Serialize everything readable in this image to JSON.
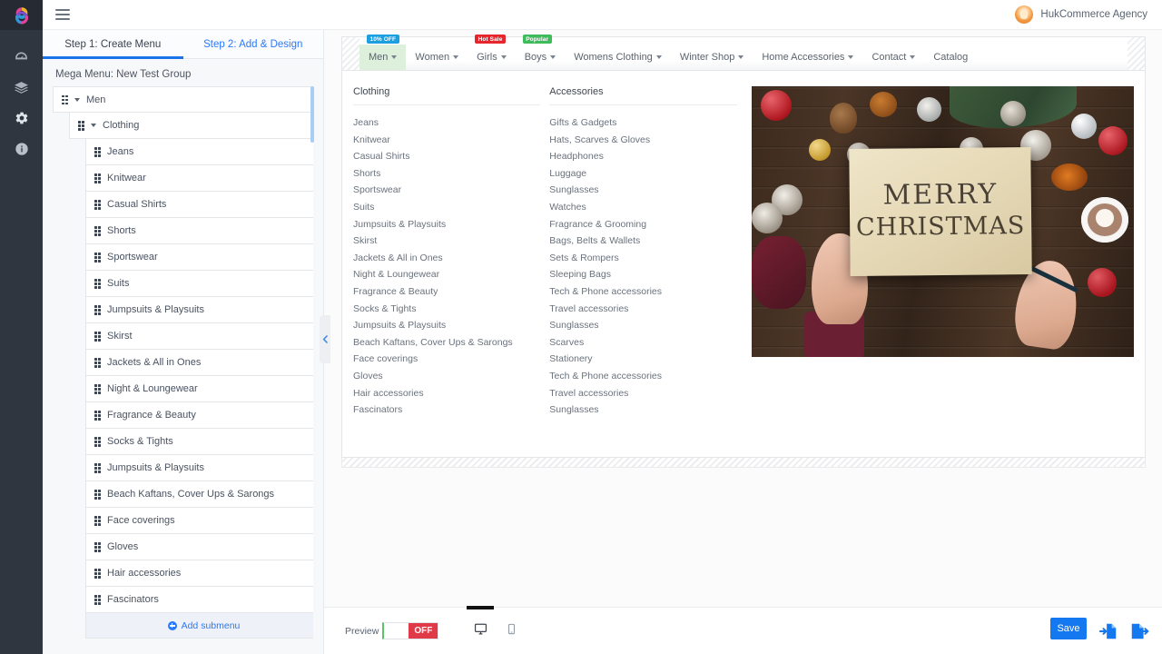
{
  "rail": {
    "logo_icon": "app-logo",
    "items": [
      {
        "icon": "dashboard-gauge-icon",
        "name": "dashboard"
      },
      {
        "icon": "layers-icon",
        "name": "layers"
      },
      {
        "icon": "gear-icon",
        "name": "settings"
      },
      {
        "icon": "info-icon",
        "name": "info"
      }
    ]
  },
  "topbar": {
    "menu_icon": "hamburger-icon",
    "brand_name": "HukCommerce Agency",
    "avatar_icon": "user-avatar"
  },
  "left_panel": {
    "steps": [
      {
        "label": "Step 1: Create Menu",
        "active": true
      },
      {
        "label": "Step 2: Add & Design",
        "active": false
      }
    ],
    "mega_menu_title": "Mega Menu: New Test Group",
    "tree": [
      {
        "label": "Men",
        "level": 1,
        "expandable": true
      },
      {
        "label": "Clothing",
        "level": 2,
        "expandable": true
      },
      {
        "label": "Jeans",
        "level": 3,
        "expandable": false
      },
      {
        "label": "Knitwear",
        "level": 3,
        "expandable": false
      },
      {
        "label": "Casual Shirts",
        "level": 3,
        "expandable": false
      },
      {
        "label": "Shorts",
        "level": 3,
        "expandable": false
      },
      {
        "label": "Sportswear",
        "level": 3,
        "expandable": false
      },
      {
        "label": "Suits",
        "level": 3,
        "expandable": false
      },
      {
        "label": "Jumpsuits & Playsuits",
        "level": 3,
        "expandable": false
      },
      {
        "label": "Skirst",
        "level": 3,
        "expandable": false
      },
      {
        "label": "Jackets & All in Ones",
        "level": 3,
        "expandable": false
      },
      {
        "label": "Night & Loungewear",
        "level": 3,
        "expandable": false
      },
      {
        "label": "Fragrance & Beauty",
        "level": 3,
        "expandable": false
      },
      {
        "label": "Socks & Tights",
        "level": 3,
        "expandable": false
      },
      {
        "label": "Jumpsuits & Playsuits",
        "level": 3,
        "expandable": false
      },
      {
        "label": "Beach Kaftans, Cover Ups & Sarongs",
        "level": 3,
        "expandable": false
      },
      {
        "label": "Face coverings",
        "level": 3,
        "expandable": false
      },
      {
        "label": "Gloves",
        "level": 3,
        "expandable": false
      },
      {
        "label": "Hair accessories",
        "level": 3,
        "expandable": false
      },
      {
        "label": "Fascinators",
        "level": 3,
        "expandable": false
      }
    ],
    "add_submenu_label": "Add submenu",
    "collapse_icon": "chevron-left-icon"
  },
  "preview": {
    "navbar": [
      {
        "label": "Men",
        "caret": true,
        "active": true,
        "badge": {
          "text": "10% OFF",
          "color": "#1b9fe0",
          "style": "blue"
        }
      },
      {
        "label": "Women",
        "caret": true,
        "active": false,
        "badge": null
      },
      {
        "label": "Girls",
        "caret": true,
        "active": false,
        "badge": {
          "text": "Hot Sale",
          "color": "#e8242c",
          "style": "red"
        }
      },
      {
        "label": "Boys",
        "caret": true,
        "active": false,
        "badge": {
          "text": "Popular",
          "color": "#3ebb5a",
          "style": "green"
        }
      },
      {
        "label": "Womens Clothing",
        "caret": true,
        "active": false,
        "badge": null
      },
      {
        "label": "Winter Shop",
        "caret": true,
        "active": false,
        "badge": null
      },
      {
        "label": "Home Accessories",
        "caret": true,
        "active": false,
        "badge": null
      },
      {
        "label": "Contact",
        "caret": true,
        "active": false,
        "badge": null
      },
      {
        "label": "Catalog",
        "caret": false,
        "active": false,
        "badge": null
      }
    ],
    "columns": [
      {
        "title": "Clothing",
        "items": [
          "Jeans",
          "Knitwear",
          "Casual Shirts",
          "Shorts",
          "Sportswear",
          "Suits",
          "Jumpsuits & Playsuits",
          "Skirst",
          "Jackets & All in Ones",
          "Night & Loungewear",
          "Fragrance & Beauty",
          "Socks & Tights",
          "Jumpsuits & Playsuits",
          "Beach Kaftans, Cover Ups & Sarongs",
          "Face coverings",
          "Gloves",
          "Hair accessories",
          "Fascinators"
        ]
      },
      {
        "title": "Accessories",
        "items": [
          "Gifts & Gadgets",
          "Hats, Scarves & Gloves",
          "Headphones",
          "Luggage",
          "Sunglasses",
          "Watches",
          "Fragrance & Grooming",
          "Bags, Belts & Wallets",
          "Sets & Rompers",
          "Sleeping Bags",
          "Tech & Phone accessories",
          "Travel accessories",
          "Sunglasses",
          "Scarves",
          "Stationery",
          "Tech & Phone accessories",
          "Travel accessories",
          "Sunglasses"
        ]
      }
    ],
    "promo_image": {
      "name": "christmas-card-photo",
      "card_line1": "MERRY",
      "card_line2": "CHRISTMAS"
    }
  },
  "bottombar": {
    "preview_label": "Preview",
    "toggle_value": "OFF",
    "desktop_icon": "desktop-icon",
    "mobile_icon": "mobile-icon",
    "save_label": "Save",
    "import_icon": "import-file-icon",
    "export_icon": "export-file-icon"
  },
  "colors": {
    "accent_blue": "#1478f0",
    "active_tab": "#1a73e8",
    "link": "#2979ff",
    "toggle_off": "#e03948",
    "active_nav_bg": "#ddf0dc"
  }
}
